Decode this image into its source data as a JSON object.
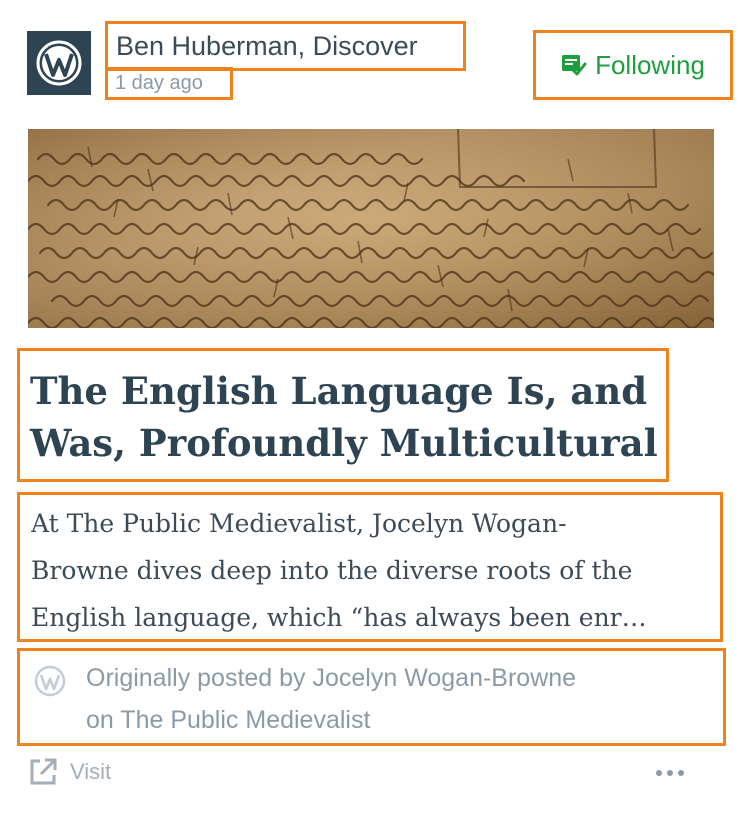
{
  "post": {
    "author": "Ben Huberman, Discover",
    "time": "1 day ago",
    "follow_label": "Following",
    "title_lines": [
      "The English Language Is, and",
      "Was, Profoundly Multicultural"
    ],
    "excerpt_lines": [
      "At The Public Medievalist, Jocelyn Wogan-",
      "Browne dives deep into the diverse roots of the",
      "English language, which “has always been enr…"
    ],
    "origin_lines": [
      "Originally posted by Jocelyn Wogan-Browne",
      "on The Public Medievalist"
    ],
    "visit_label": "Visit"
  },
  "icons": {
    "avatar": "wordpress-logo-icon",
    "follow": "reader-following-icon",
    "origin": "wordpress-logo-icon",
    "visit": "external-link-icon",
    "more": "ellipsis-icon"
  },
  "colors": {
    "accent_green": "#1e9e3e",
    "title": "#2e4453",
    "meta": "#8c9aa6",
    "highlight": "#f0821e"
  }
}
